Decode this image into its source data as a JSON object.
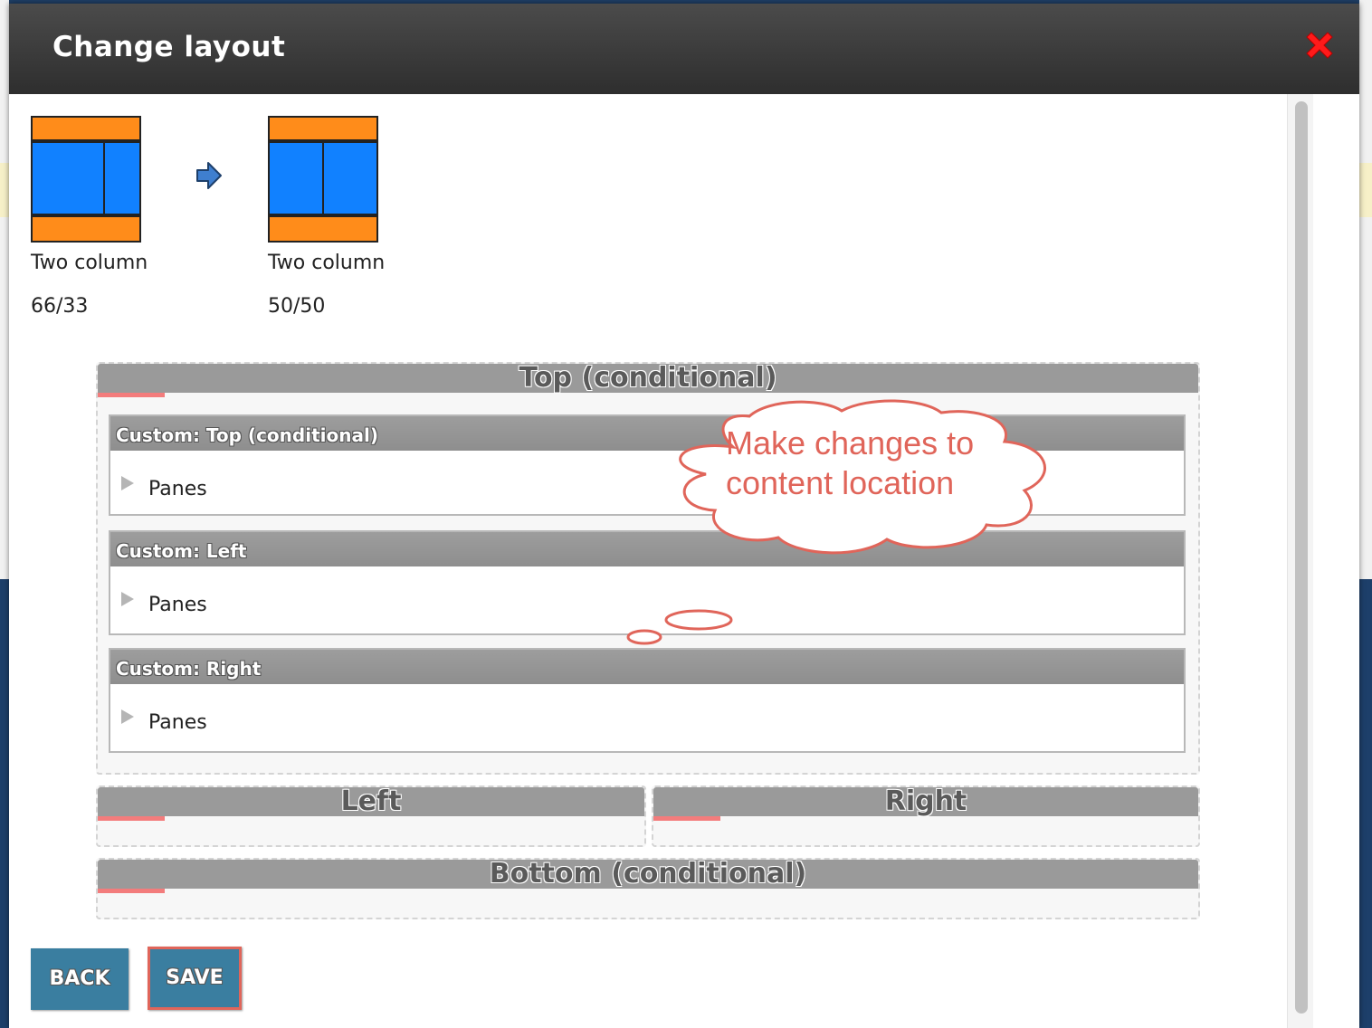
{
  "dialog": {
    "title": "Change layout",
    "close_icon": "close-icon"
  },
  "layouts": {
    "from": {
      "label_line1": "Two column",
      "label_line2": "66/33"
    },
    "to": {
      "label_line1": "Two column",
      "label_line2": "50/50"
    },
    "arrow_icon": "right-arrow-icon"
  },
  "regions": {
    "top": {
      "title": "Top (conditional)",
      "panes": [
        {
          "header": "Custom: Top (conditional)",
          "item": "Panes"
        },
        {
          "header": "Custom: Left",
          "item": "Panes"
        },
        {
          "header": "Custom: Right",
          "item": "Panes"
        }
      ]
    },
    "left": {
      "title": "Left"
    },
    "right": {
      "title": "Right"
    },
    "bottom": {
      "title": "Bottom (conditional)"
    }
  },
  "callout": {
    "text_line1": "Make changes to",
    "text_line2": "content location"
  },
  "buttons": {
    "back": "BACK",
    "save": "SAVE"
  },
  "colors": {
    "accent_orange": "#ff8c1a",
    "accent_blue": "#1181ff",
    "button_blue": "#3a7ea0",
    "annotation_red": "#e0655a",
    "close_red": "#ff1a1a"
  }
}
